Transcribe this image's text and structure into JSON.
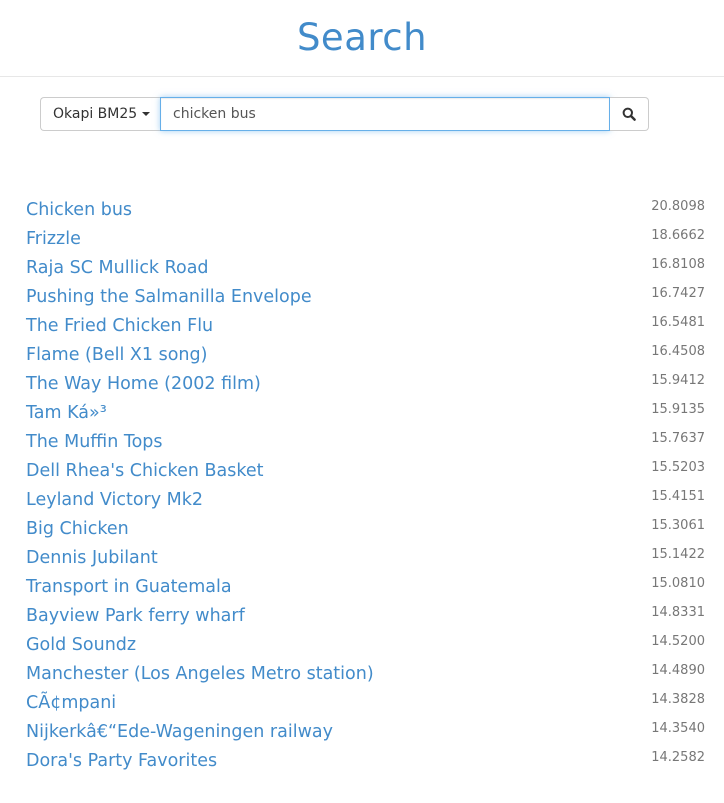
{
  "header": {
    "title": "Search"
  },
  "search": {
    "ranker_label": "Okapi BM25",
    "query": "chicken bus",
    "search_icon": "search-icon"
  },
  "results": [
    {
      "title": "Chicken bus",
      "score": "20.8098"
    },
    {
      "title": "Frizzle",
      "score": "18.6662"
    },
    {
      "title": "Raja SC Mullick Road",
      "score": "16.8108"
    },
    {
      "title": "Pushing the Salmanilla Envelope",
      "score": "16.7427"
    },
    {
      "title": "The Fried Chicken Flu",
      "score": "16.5481"
    },
    {
      "title": "Flame (Bell X1 song)",
      "score": "16.4508"
    },
    {
      "title": "The Way Home (2002 film)",
      "score": "15.9412"
    },
    {
      "title": "Tam Ká»³",
      "score": "15.9135"
    },
    {
      "title": "The Muffin Tops",
      "score": "15.7637"
    },
    {
      "title": "Dell Rhea's Chicken Basket",
      "score": "15.5203"
    },
    {
      "title": "Leyland Victory Mk2",
      "score": "15.4151"
    },
    {
      "title": "Big Chicken",
      "score": "15.3061"
    },
    {
      "title": "Dennis Jubilant",
      "score": "15.1422"
    },
    {
      "title": "Transport in Guatemala",
      "score": "15.0810"
    },
    {
      "title": "Bayview Park ferry wharf",
      "score": "14.8331"
    },
    {
      "title": "Gold Soundz",
      "score": "14.5200"
    },
    {
      "title": "Manchester (Los Angeles Metro station)",
      "score": "14.4890"
    },
    {
      "title": "CÃ¢mpani",
      "score": "14.3828"
    },
    {
      "title": "Nijkerkâ€“Ede-Wageningen railway",
      "score": "14.3540"
    },
    {
      "title": "Dora's Party Favorites",
      "score": "14.2582"
    }
  ],
  "colors": {
    "accent": "#428bca",
    "score": "#777777",
    "focus_border": "#66afe9"
  }
}
